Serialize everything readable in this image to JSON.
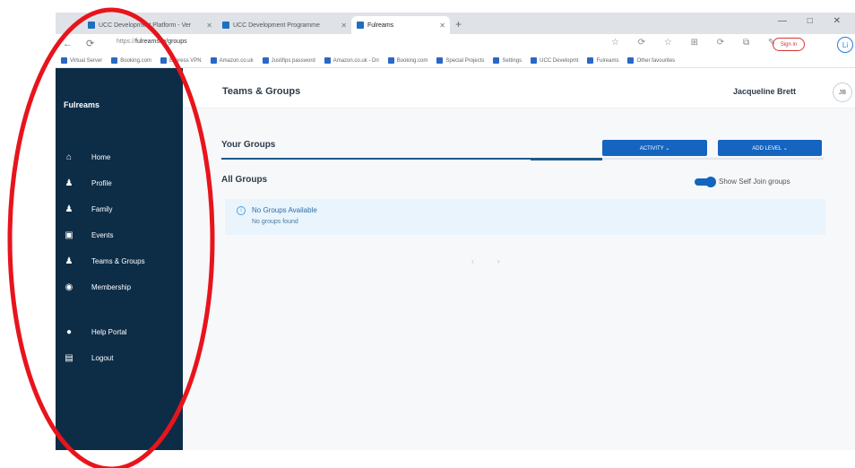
{
  "browser": {
    "tabs": [
      {
        "label": "UCC Development Platform - Ver"
      },
      {
        "label": "UCC Development Programme"
      },
      {
        "label": "Fulreams"
      }
    ],
    "new_tab": "+",
    "window_controls": "— □ ✕",
    "nav_buttons": "← ⟳",
    "url_prefix": "https://",
    "url_domain": "fulreams.ie/groups",
    "extensions": "☆ ⟳ ☆ ⊞ ⟳ ⧉ ✎",
    "profile_pill": "Sign in",
    "edge_avatar": "Li",
    "bookmarks": [
      "Virtual Server",
      "Booking.com",
      "Express VPN",
      "Amazon.co.uk",
      "Justifips password",
      "Amazon.co.uk - Dri",
      "Booking.com",
      "Special Projects",
      "Settings",
      "UCC Developmt",
      "Fulreams",
      "Other favourites"
    ]
  },
  "sidebar": {
    "brand": "Fulreams",
    "items": [
      {
        "label": "Home",
        "icon": "home-icon",
        "glyph": "⌂"
      },
      {
        "label": "Profile",
        "icon": "person-icon",
        "glyph": "♟"
      },
      {
        "label": "Family",
        "icon": "family-icon",
        "glyph": "♟"
      },
      {
        "label": "Events",
        "icon": "calendar-icon",
        "glyph": "▣"
      },
      {
        "label": "Teams & Groups",
        "icon": "group-icon",
        "glyph": "♟"
      },
      {
        "label": "Membership",
        "icon": "shield-icon",
        "glyph": "◉"
      }
    ],
    "bottom_items": [
      {
        "label": "Help Portal",
        "icon": "help-icon",
        "glyph": "●"
      },
      {
        "label": "Logout",
        "icon": "logout-icon",
        "glyph": "▤"
      }
    ]
  },
  "header": {
    "title": "Teams & Groups",
    "user_name": "Jacqueline Brett",
    "user_initials": "JB"
  },
  "groups": {
    "your_groups": "Your Groups",
    "activity_button": "ACTIVITY ⌄",
    "add_level_button": "ADD LEVEL ⌄",
    "all_groups": "All Groups",
    "toggle_label": "Show Self Join groups",
    "toggle_on": true,
    "empty_title": "No Groups Available",
    "empty_subtitle": "No groups found",
    "pager": "‹ ›"
  },
  "colors": {
    "sidebar_bg": "#0d2d47",
    "accent": "#1464c0",
    "annotation": "#e8141c"
  }
}
